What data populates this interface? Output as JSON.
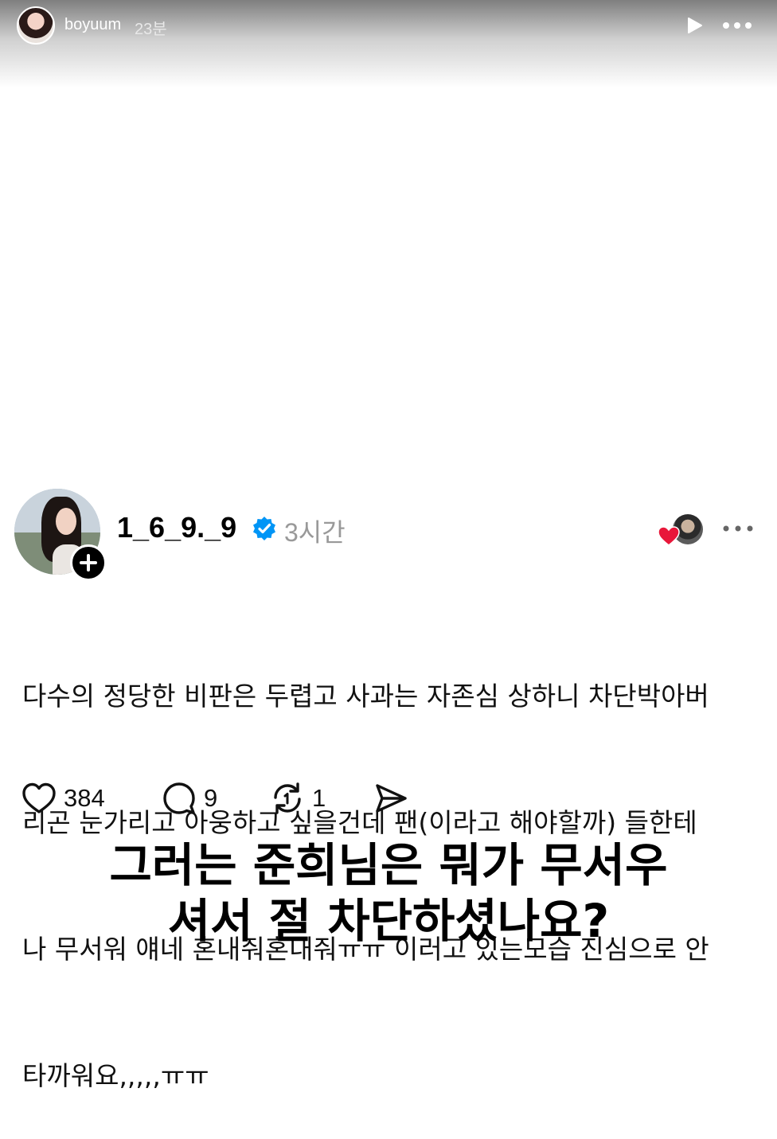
{
  "story": {
    "username": "boyuum",
    "time": "23분"
  },
  "post": {
    "username": "1_6_9._9",
    "time": "3시간",
    "lines": [
      "다수의 정당한 비판은 두렵고 사과는 자존심 상하니 차단박아버",
      "리곤 눈가리고 아웅하고 싶을건데 팬(이라고 해야할까) 들한테",
      "나 무서워 얘네 혼내줘혼내줘ㅠㅠ 이러고 있는모습 진심으로 안",
      "타까워요,,,,,ㅠㅠ"
    ],
    "likes": "384",
    "replies": "9",
    "reposts": "1"
  },
  "caption": {
    "line1": "그러는 준희님은 뭐가 무서우",
    "line2": "셔서 절 차단하셨나요?"
  },
  "icons": {
    "play": "play-icon",
    "more": "more-icon",
    "verified": "verified-badge-icon",
    "heart": "heart-icon",
    "reply": "comment-icon",
    "repost": "repost-icon",
    "share": "send-icon"
  },
  "colors": {
    "verified": "#0095f6",
    "heart_badge": "#e8173a",
    "muted": "#999999"
  }
}
